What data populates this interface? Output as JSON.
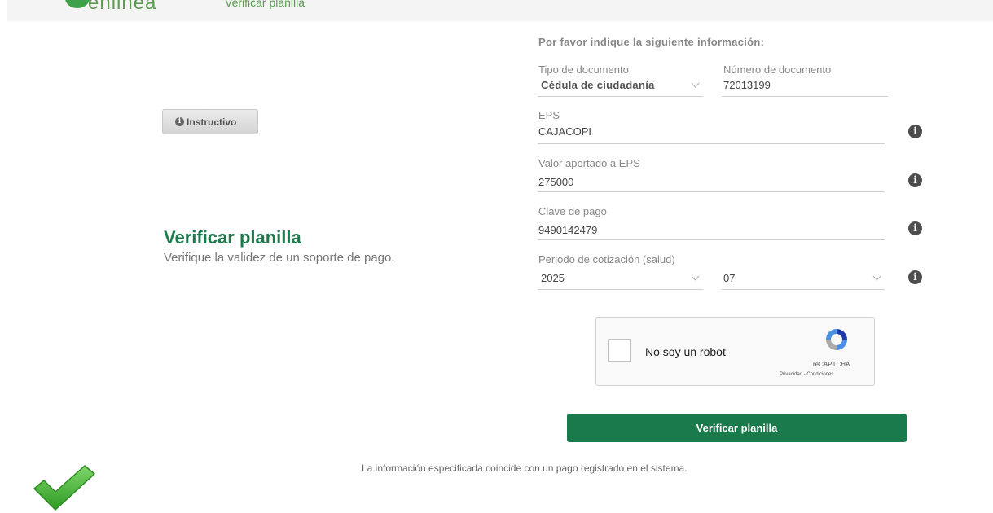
{
  "header": {
    "logo_text": "enlinea",
    "nav_link": "Verificar planilla"
  },
  "side": {
    "instructivo_label": "Instructivo",
    "title": "Verificar planilla",
    "subtitle": "Verifique la validez de un soporte de pago."
  },
  "form": {
    "heading": "Por favor indique la siguiente información:",
    "tipo_documento": {
      "label": "Tipo de documento",
      "value": "Cédula de ciudadanía"
    },
    "numero_documento": {
      "label": "Número de documento",
      "value": "72013199"
    },
    "eps": {
      "label": "EPS",
      "value": "CAJACOPI"
    },
    "valor_aportado": {
      "label": "Valor aportado a EPS",
      "value": "275000"
    },
    "clave_pago": {
      "label": "Clave de pago",
      "value": "9490142479"
    },
    "periodo": {
      "label": "Periodo de cotización (salud)",
      "year": "2025",
      "month": "07"
    }
  },
  "captcha": {
    "label": "No soy un robot",
    "brand": "reCAPTCHA",
    "links": "Privacidad - Condiciones"
  },
  "submit_label": "Verificar planilla",
  "result_message": "La información especificada coincide con un pago registrado en el sistema.",
  "colors": {
    "primary_green": "#1a7a4c",
    "success_check": "#4cb33a"
  },
  "icons": [
    "info-icon",
    "chevron-down-icon",
    "checkmark-icon",
    "recaptcha-icon"
  ]
}
